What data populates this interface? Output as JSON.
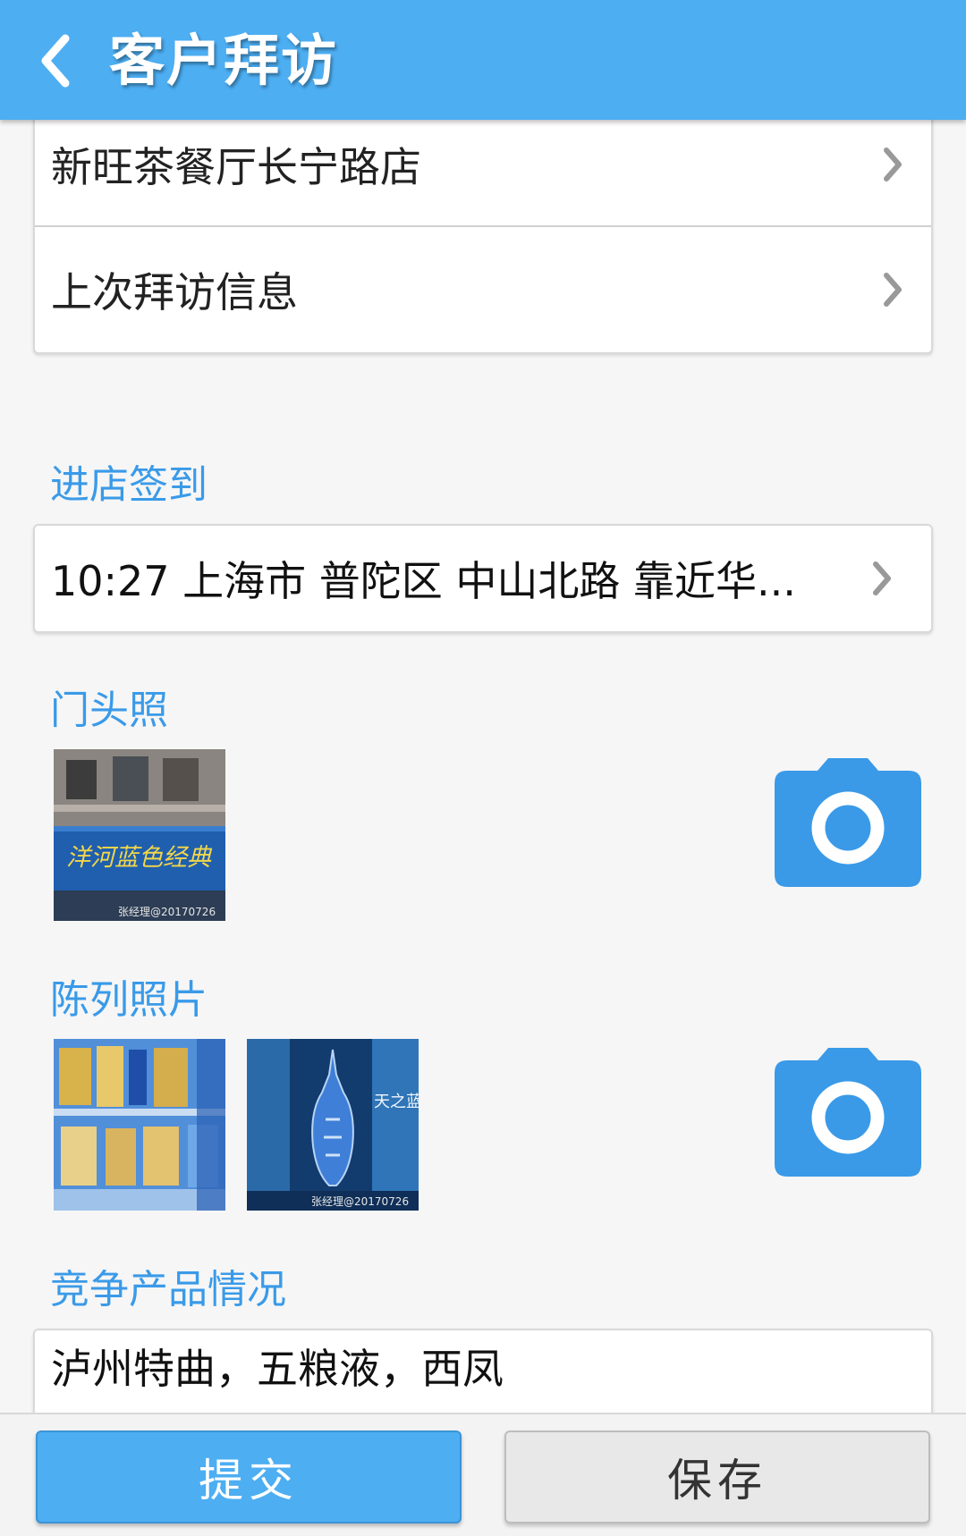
{
  "header": {
    "title": "客户拜访"
  },
  "customer_card": {
    "store_name": "新旺茶餐厅长宁路店",
    "last_visit_label": "上次拜访信息"
  },
  "checkin": {
    "section_title": "进店签到",
    "value": "10:27 上海市 普陀区 中山北路 靠近华..."
  },
  "storefront": {
    "section_title": "门头照",
    "photos": [
      {
        "sign_text": "洋河蓝色经典",
        "watermark": "张经理@20170726"
      }
    ]
  },
  "display": {
    "section_title": "陈列照片",
    "photos": [
      {
        "watermark": ""
      },
      {
        "label_text": "天之蓝",
        "watermark": "张经理@20170726"
      }
    ]
  },
  "competition": {
    "section_title": "竞争产品情况",
    "value": "泸州特曲，五粮液，西凤"
  },
  "footer": {
    "submit_label": "提交",
    "save_label": "保存"
  },
  "colors": {
    "accent": "#4daef2",
    "section_title": "#3a9ae8"
  }
}
